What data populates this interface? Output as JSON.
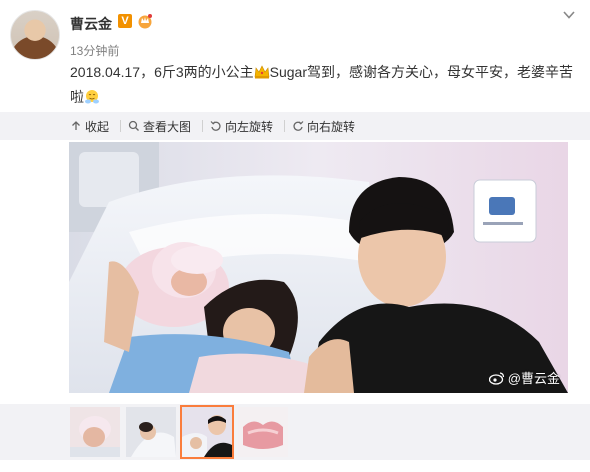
{
  "post": {
    "author": "曹云金",
    "verified_badge": "V",
    "time": "13分钟前",
    "text_part1": "2018.04.17，6斤3两的小公主",
    "emoji1": "crown-emoji",
    "text_part2": "Sugar驾到，感谢各方关心，母女平安，老婆辛苦啦",
    "emoji2": "hug-emoji"
  },
  "toolbar": {
    "collapse_label": "收起",
    "view_large_label": "查看大图",
    "rotate_left_label": "向左旋转",
    "rotate_right_label": "向右旋转"
  },
  "photo": {
    "watermark": "@曹云金",
    "description_icon": "weibo-icon"
  },
  "thumbnails": {
    "count": 4,
    "selected_index": 2
  },
  "colors": {
    "toolbar_bg": "#f2f2f5",
    "accent": "#fa7d3c",
    "verified": "#f29100"
  }
}
